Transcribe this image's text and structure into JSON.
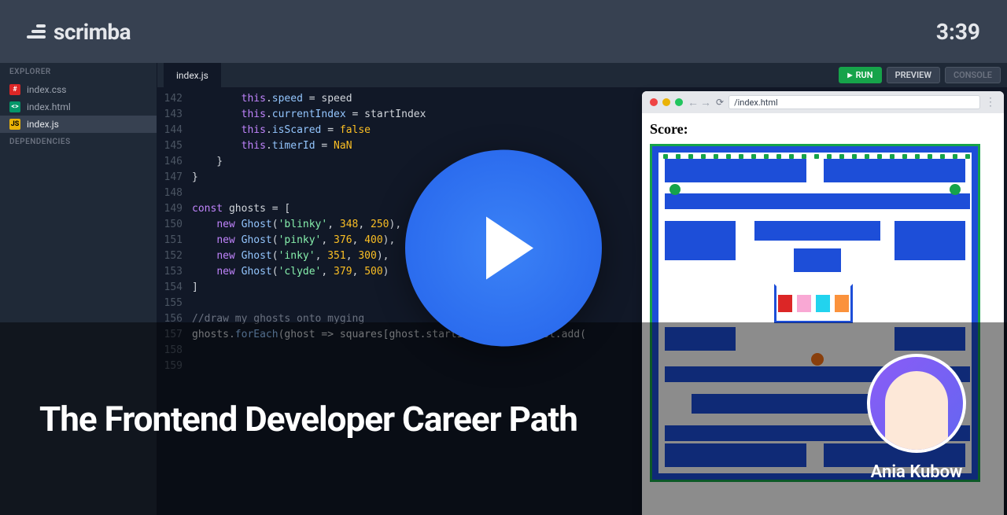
{
  "header": {
    "logo": "scrimba",
    "timer": "3:39"
  },
  "sidebar": {
    "explorer_label": "EXPLORER",
    "dependencies_label": "DEPENDENCIES",
    "files": [
      {
        "name": "index.css",
        "type": "css"
      },
      {
        "name": "index.html",
        "type": "html"
      },
      {
        "name": "index.js",
        "type": "js",
        "active": true
      }
    ]
  },
  "editor": {
    "tab_label": "index.js",
    "run_label": "RUN",
    "preview_label": "PREVIEW",
    "console_label": "CONSOLE",
    "lines": [
      {
        "n": 142,
        "html": "        <span class='this'>this</span>.<span class='prop'>speed</span> = speed"
      },
      {
        "n": 143,
        "html": "        <span class='this'>this</span>.<span class='prop'>currentIndex</span> = startIndex"
      },
      {
        "n": 144,
        "html": "        <span class='this'>this</span>.<span class='prop'>isScared</span> = <span class='bool'>false</span>"
      },
      {
        "n": 145,
        "html": "        <span class='this'>this</span>.<span class='prop'>timerId</span> = <span class='num'>NaN</span>"
      },
      {
        "n": 146,
        "html": "    }"
      },
      {
        "n": 147,
        "html": "}"
      },
      {
        "n": 148,
        "html": ""
      },
      {
        "n": 149,
        "html": "<span class='kw'>const</span> ghosts = ["
      },
      {
        "n": 150,
        "html": "    <span class='kw'>new</span> <span class='func'>Ghost</span>(<span class='str'>'blinky'</span>, <span class='num'>348</span>, <span class='num'>250</span>),"
      },
      {
        "n": 151,
        "html": "    <span class='kw'>new</span> <span class='func'>Ghost</span>(<span class='str'>'pinky'</span>, <span class='num'>376</span>, <span class='num'>400</span>),"
      },
      {
        "n": 152,
        "html": "    <span class='kw'>new</span> <span class='func'>Ghost</span>(<span class='str'>'inky'</span>, <span class='num'>351</span>, <span class='num'>300</span>),"
      },
      {
        "n": 153,
        "html": "    <span class='kw'>new</span> <span class='func'>Ghost</span>(<span class='str'>'clyde'</span>, <span class='num'>379</span>, <span class='num'>500</span>)"
      },
      {
        "n": 154,
        "html": "]"
      },
      {
        "n": 155,
        "html": ""
      },
      {
        "n": 156,
        "html": "<span class='comment'>//draw my ghosts onto myging</span>"
      },
      {
        "n": 157,
        "html": "ghosts.<span class='func'>forEach</span>(ghost => squares[ghost.startIndex].classList.add("
      },
      {
        "n": 158,
        "html": ""
      },
      {
        "n": 159,
        "html": ""
      }
    ]
  },
  "preview": {
    "url": "/index.html",
    "score_label": "Score:"
  },
  "overlay": {
    "title": "The Frontend Developer Career Path",
    "instructor": "Ania Kubow"
  }
}
